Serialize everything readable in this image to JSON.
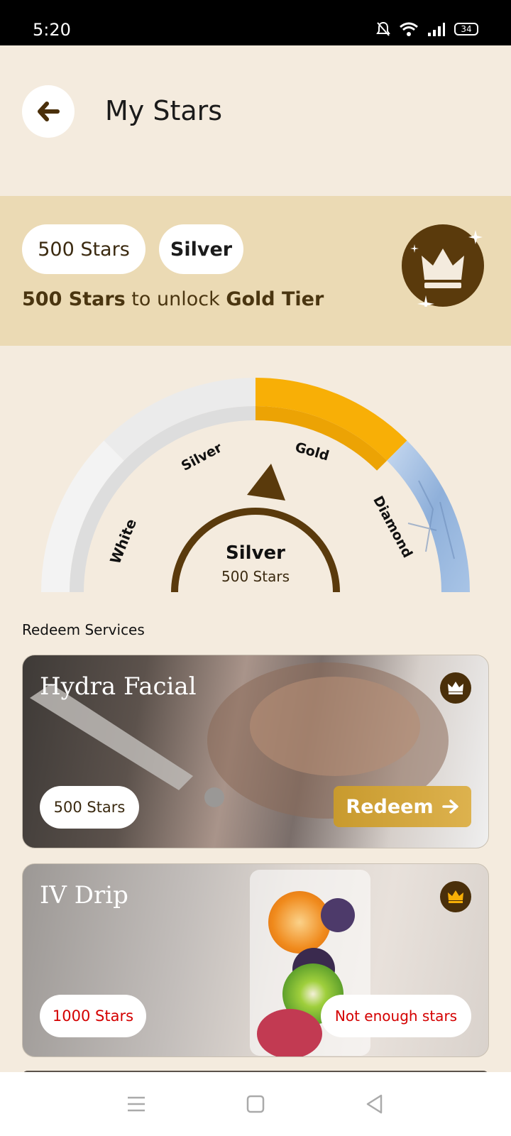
{
  "status_bar": {
    "time": "5:20",
    "battery": "34"
  },
  "header": {
    "title": "My Stars"
  },
  "tier_panel": {
    "stars_pill": "500 Stars",
    "tier_pill": "Silver",
    "unlock_stars": "500 Stars",
    "unlock_middle": " to unlock ",
    "unlock_tier": "Gold Tier"
  },
  "gauge": {
    "labels": [
      "White",
      "Silver",
      "Gold",
      "Diamond"
    ],
    "current_tier": "Silver",
    "current_stars": "500 Stars",
    "colors": {
      "white": "#F3F3F3",
      "silver": "#EBEBEB",
      "gold": "#F8AF06",
      "diamond": "#9CB9DD",
      "needle": "#5A3A0C"
    }
  },
  "section_title": "Redeem Services",
  "services": [
    {
      "title": "Hydra Facial",
      "stars": "500 Stars",
      "action": "Redeem"
    },
    {
      "title": "IV Drip",
      "stars": "1000 Stars",
      "action": "Not enough stars"
    }
  ],
  "colors": {
    "background": "#F4EBDE",
    "panel": "#EBDAB4",
    "accent_brown": "#5A3A0C",
    "warning_red": "#D40000"
  }
}
